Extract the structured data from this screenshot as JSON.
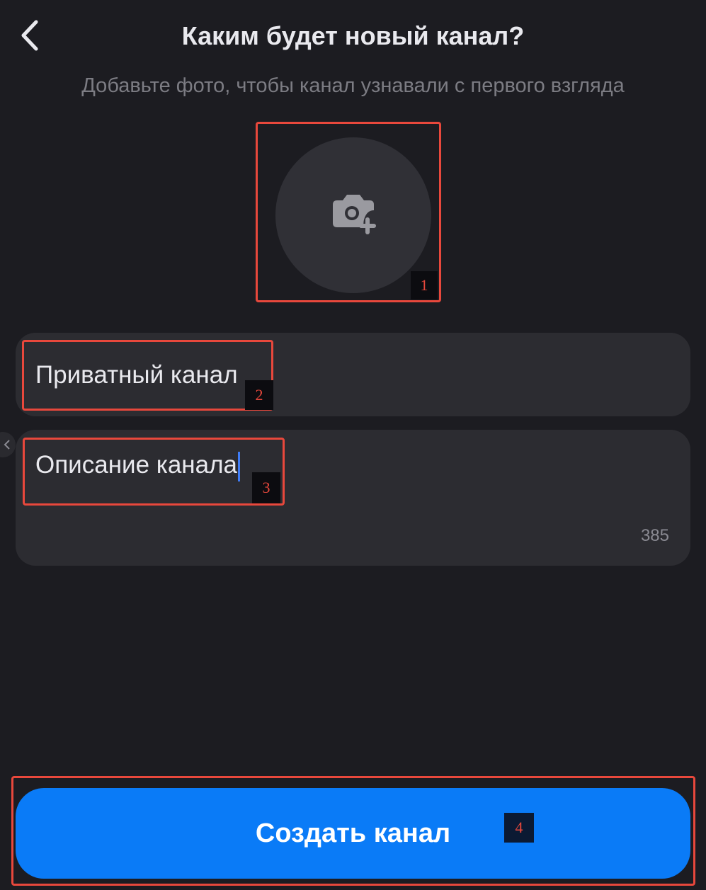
{
  "header": {
    "back_icon": "chevron-left-icon",
    "title": "Каким будет новый канал?"
  },
  "subtitle": "Добавьте фото, чтобы канал узнавали с первого взгляда",
  "avatar": {
    "icon": "camera-plus-icon"
  },
  "form": {
    "name_value": "Приватный канал",
    "description_value": "Описание канала",
    "description_counter": "385"
  },
  "create_button": {
    "label": "Создать канал"
  },
  "markers": [
    "1",
    "2",
    "3",
    "4"
  ],
  "colors": {
    "background": "#1c1c21",
    "field": "#2c2c31",
    "accent": "#0a7bf7",
    "caret": "#3f7cf5",
    "annotation": "#e8483c"
  }
}
